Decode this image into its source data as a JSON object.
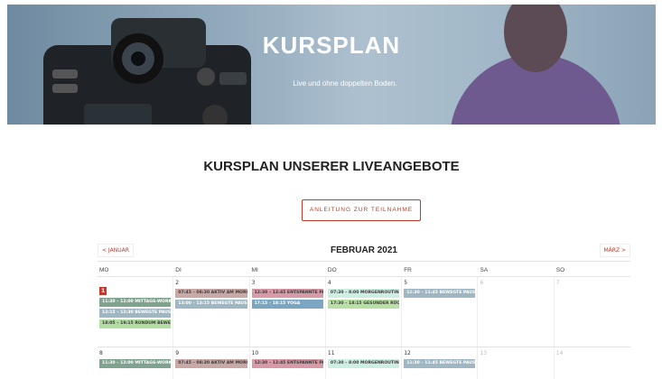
{
  "hero": {
    "title": "KURSPLAN",
    "subtitle": "Live und ohne doppelten Boden."
  },
  "section": {
    "title": "KURSPLAN UNSERER LIVEANGEBOTE",
    "cta": "ANLEITUNG ZUR TEILNAHME"
  },
  "calendar": {
    "month": "FEBRUAR 2021",
    "prev": "< JANUAR",
    "next": "MÄRZ >",
    "weekdays": [
      "MO",
      "DI",
      "MI",
      "DO",
      "FR",
      "SA",
      "SO"
    ],
    "week1": {
      "days": [
        "1",
        "2",
        "3",
        "4",
        "5",
        "6",
        "7"
      ],
      "mo": [
        "11:30 – 12:00 MITTAGS-WORKOUT",
        "12:15 – 12:30 BEWEGTE PAUSE",
        "18:05 – 19:15 RUNDUM BEWEGLICH"
      ],
      "di": [
        "07:45 – 08:30 AKTIV AM MORGEN",
        "13:00 – 13:15 BEWEGTE PAUSE"
      ],
      "mi": [
        "12:30 – 12:45 ENTSPANNTE PAUSE",
        "17:15 – 18:15 YOGA"
      ],
      "do": [
        "07:30 – 8:00 MORGENROUTINE",
        "17:30 – 18:15 GESUNDER RÜCKEN"
      ],
      "fr": [
        "11:30 – 11:45 BEWEGTE PAUSE"
      ]
    },
    "week2": {
      "days": [
        "8",
        "9",
        "10",
        "11",
        "12",
        "13",
        "14"
      ],
      "mo": [
        "11:30 – 12:00 MITTAGS-WORKOUT"
      ],
      "di": [
        "07:45 – 08:30 AKTIV AM MORGEN"
      ],
      "mi": [
        "12:30 – 12:45 ENTSPANNTE PAUSE"
      ],
      "do": [
        "07:30 – 8:00 MORGENROUTINE"
      ],
      "fr": [
        "11:30 – 11:45 BEWEGTE PAUSE"
      ]
    }
  },
  "colors": {
    "accent": "#c0392b",
    "workout": "#7fa38f",
    "aktiv": "#c9a9a5",
    "entspannt": "#d89aa6",
    "morgen": "#cdeee2",
    "pause": "#9fb7c3",
    "yoga": "#7aa6c1",
    "ruecken": "#b8e0a4",
    "beweglich": "#b2dca0"
  }
}
